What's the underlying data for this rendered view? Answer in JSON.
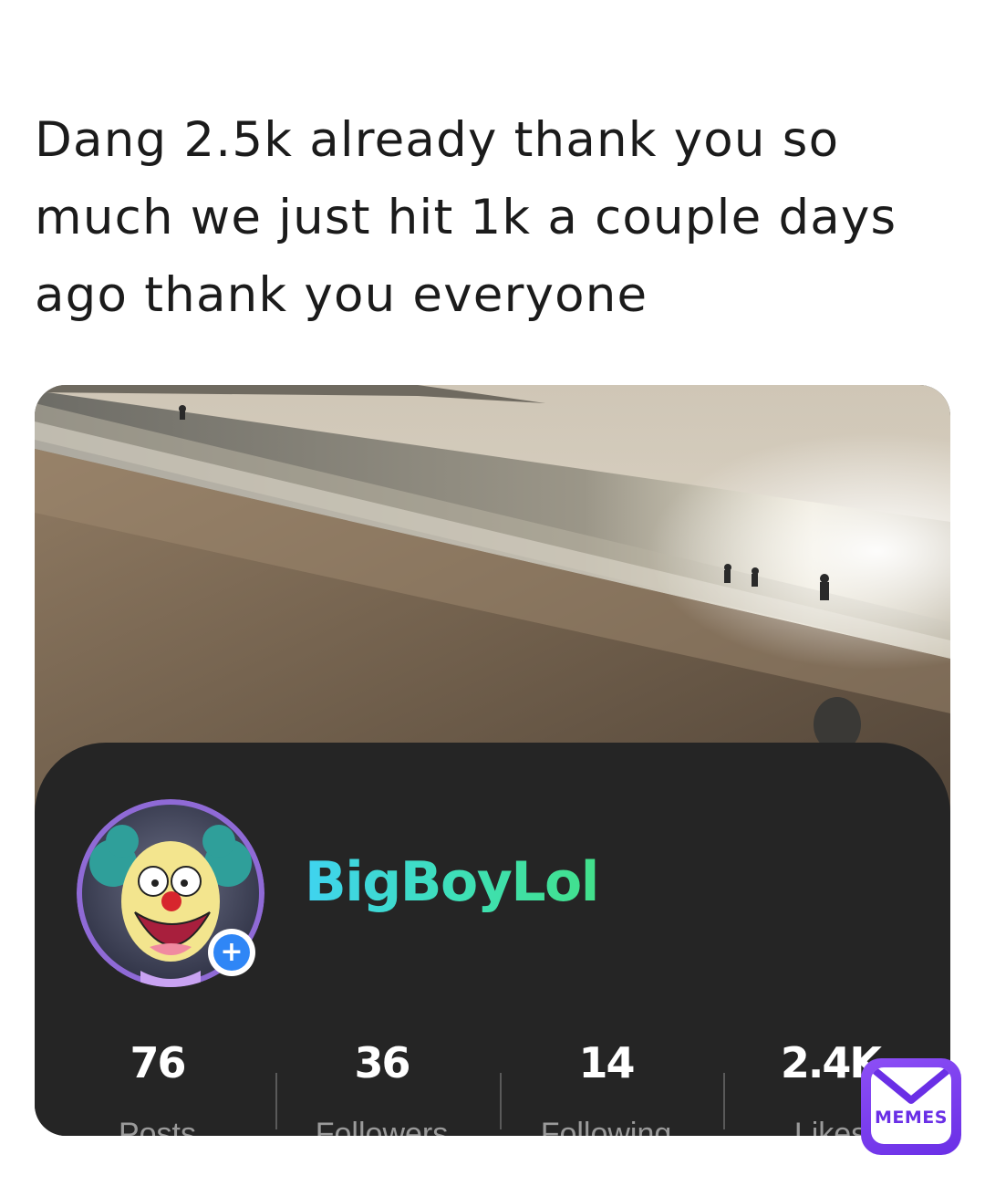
{
  "post": {
    "caption": "Dang 2.5k already thank you so much we just hit 1k a couple days ago thank you everyone"
  },
  "screenshot": {
    "photo": {
      "subject": "beach-shoreline-photo"
    },
    "profile": {
      "username": "BigBoyLol",
      "avatar_icon": "clown-avatar",
      "add_icon": "plus-icon",
      "username_gradient": [
        "#3fd3f0",
        "#3ee0b4",
        "#42e08a"
      ],
      "stats": [
        {
          "value": "76",
          "label": "Posts"
        },
        {
          "value": "36",
          "label": "Followers"
        },
        {
          "value": "14",
          "label": "Following"
        },
        {
          "value": "2.4K",
          "label": "Likes"
        }
      ]
    }
  },
  "watermark": {
    "label": "MEMES",
    "icon": "envelope-icon",
    "color": "#7a3cf0"
  },
  "colors": {
    "panel_bg": "#252525",
    "badge_blue": "#2f86f6"
  }
}
